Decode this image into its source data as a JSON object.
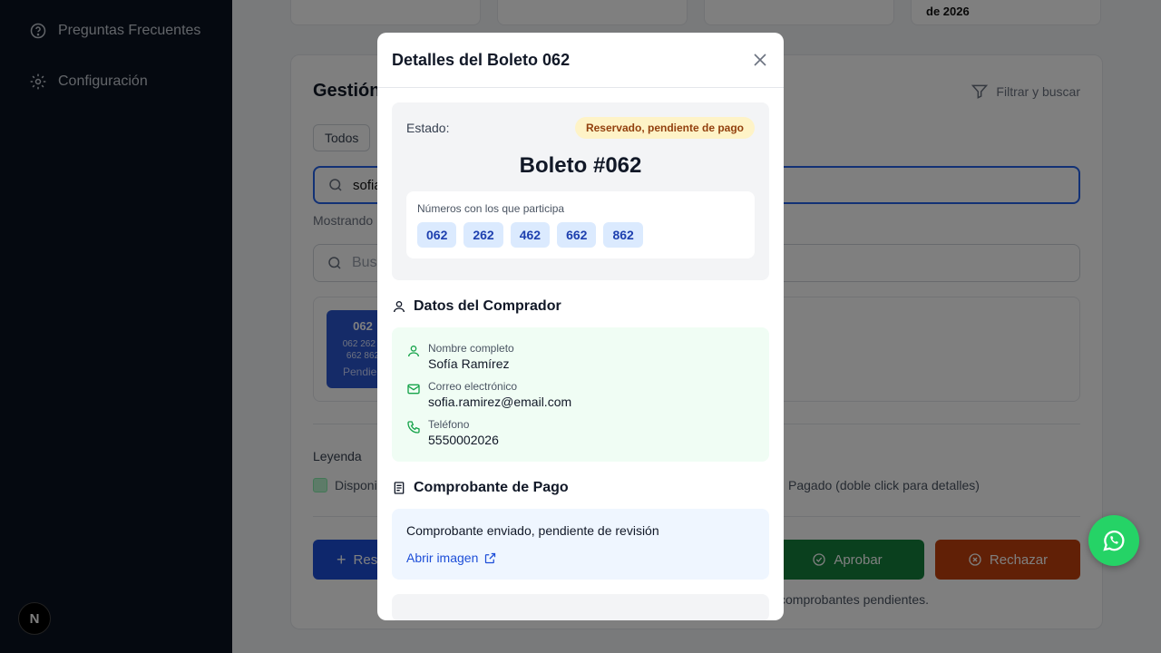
{
  "sidebar": {
    "items": [
      {
        "label": "Preguntas Frecuentes",
        "icon": "help-circle-icon"
      },
      {
        "label": "Configuración",
        "icon": "gear-icon"
      }
    ],
    "badge": "N"
  },
  "background": {
    "stat_date": "de 2026",
    "panel_title": "Gestión",
    "filter_label": "Filtrar y buscar",
    "chip_all": "Todos",
    "search_value": "sofia",
    "showing_text": "Mostrando",
    "search2_placeholder": "Busc",
    "ticket": {
      "number": "062",
      "numbers_line1": "062 262 4",
      "numbers_line2": "662 862",
      "status": "Pendien"
    },
    "legend_title": "Leyenda",
    "legend_available": "Disponi",
    "legend_paid": "Pagado (doble click para detalles)",
    "btn_reserve": "Res",
    "btn_approve": "Aprobar",
    "btn_reject": "Rechazar",
    "pending_note": "comprobantes pendientes."
  },
  "modal": {
    "title": "Detalles del Boleto 062",
    "state_label": "Estado:",
    "state_badge": "Reservado, pendiente de pago",
    "ticket_title": "Boleto #062",
    "numbers_label": "Números con los que participa",
    "numbers": [
      "062",
      "262",
      "462",
      "662",
      "862"
    ],
    "buyer_section": "Datos del Comprador",
    "buyer": {
      "name_label": "Nombre completo",
      "name": "Sofía Ramírez",
      "email_label": "Correo electrónico",
      "email": "sofia.ramirez@email.com",
      "phone_label": "Teléfono",
      "phone": "5550002026"
    },
    "receipt_section": "Comprobante de Pago",
    "receipt_text": "Comprobante enviado, pendiente de revisión",
    "open_image": "Abrir imagen"
  },
  "colors": {
    "sidebar_bg": "#0b1220",
    "badge_pending_bg": "#fef3c7",
    "badge_pending_text": "#92400e",
    "number_chip_bg": "#dbeafe",
    "buyer_bg": "#f0fdf4",
    "receipt_bg": "#eff6ff",
    "approve": "#15803d",
    "reject": "#c2410c",
    "whatsapp": "#25d366"
  }
}
